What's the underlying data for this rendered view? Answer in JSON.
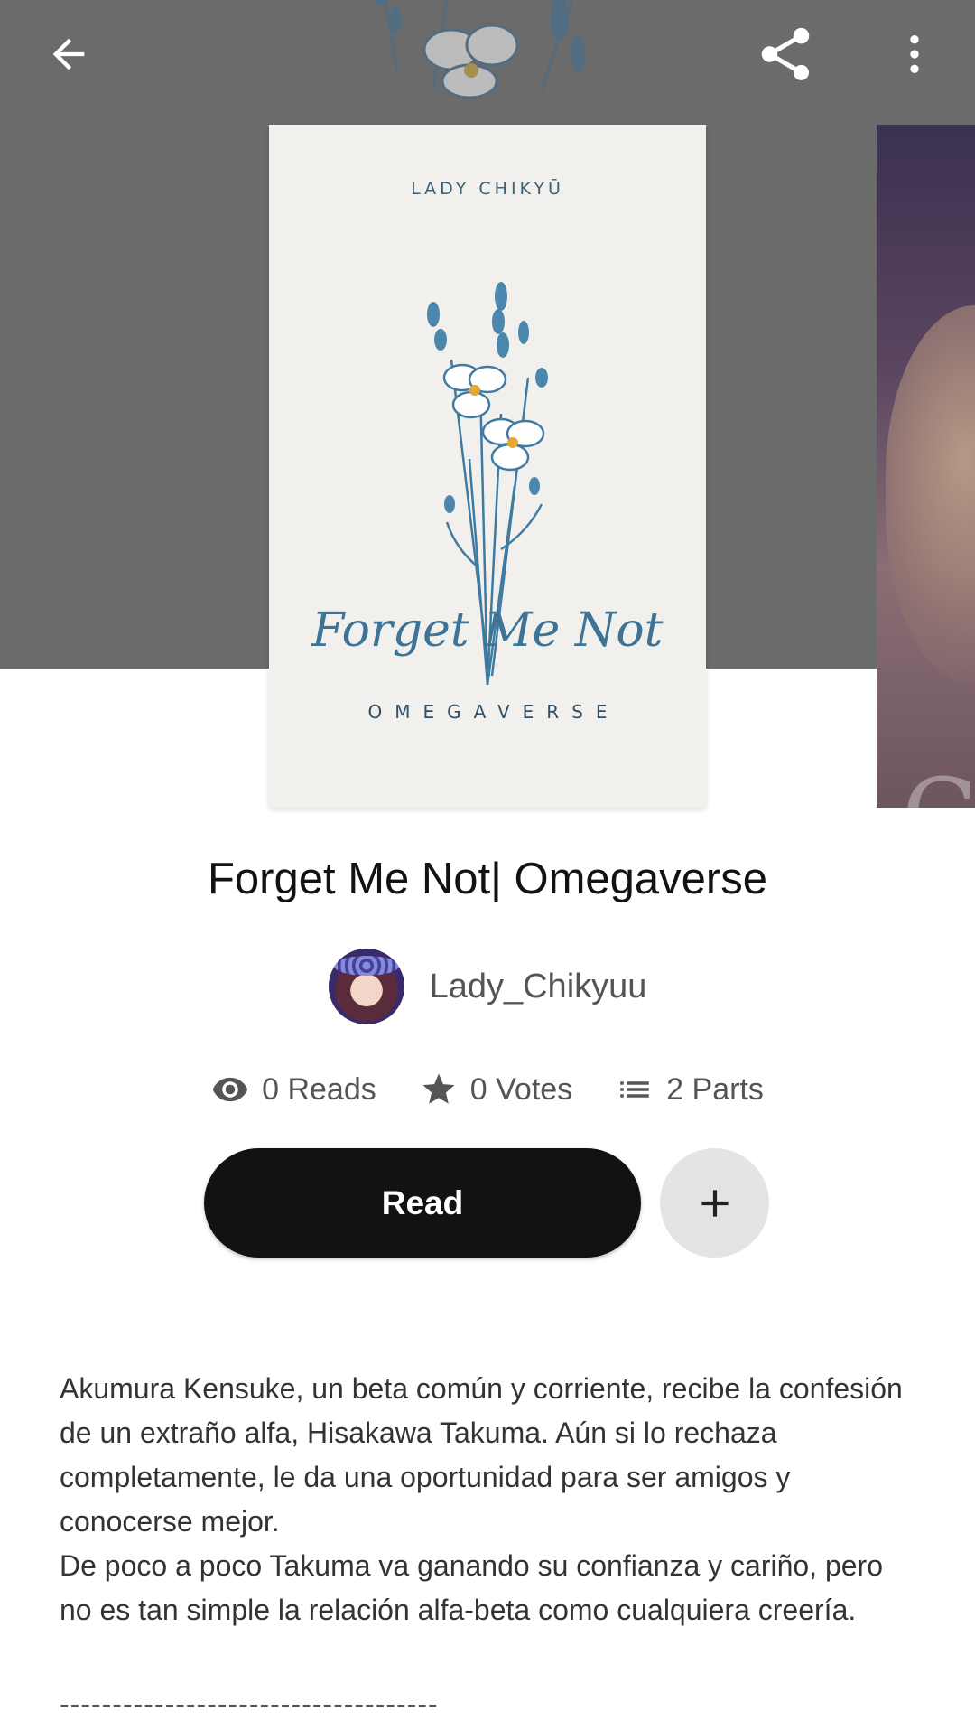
{
  "header": {
    "back_icon": "arrow-left-icon",
    "share_icon": "share-icon",
    "more_icon": "more-vertical-icon"
  },
  "cover": {
    "author": "LADY CHIKYŪ",
    "title": "Forget Me Not",
    "subtitle": "OMEGAVERSE"
  },
  "story": {
    "title": "Forget Me Not| Omegaverse",
    "author": "Lady_Chikyuu"
  },
  "stats": {
    "reads": "0 Reads",
    "votes": "0 Votes",
    "parts": "2 Parts"
  },
  "actions": {
    "read_label": "Read",
    "add_icon": "plus-icon"
  },
  "description": {
    "paragraph1": "Akumura Kensuke, un beta común y corriente, recibe la confesión de un extraño alfa, Hisakawa Takuma. Aún si lo rechaza completamente, le da una oportunidad para ser amigos y conocerse mejor.",
    "paragraph2": "De poco a poco Takuma va ganando su confianza y cariño, pero no es tan simple la relación alfa-beta como cualquiera creería.",
    "divider": "------------------------------------"
  },
  "colors": {
    "hero_bg": "#6b6b6b",
    "read_button": "#121212",
    "add_button": "#e4e4e4",
    "cover_bg": "#f2f0ed",
    "cover_ink": "#3d7496"
  }
}
